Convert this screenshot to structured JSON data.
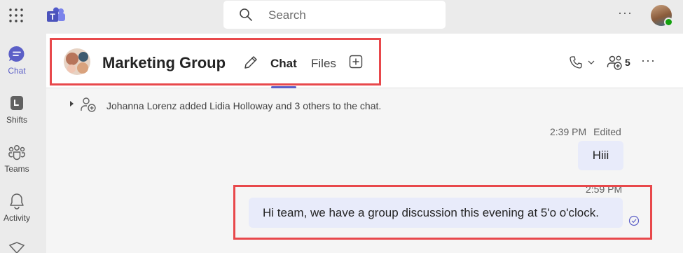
{
  "topbar": {
    "search_placeholder": "Search",
    "more": "···",
    "icons": [
      "apps-waffle-icon",
      "teams-logo-icon",
      "search-icon",
      "more-icon",
      "user-avatar"
    ]
  },
  "rail": {
    "items": [
      {
        "label": "Chat",
        "icon": "chat-icon",
        "active": true
      },
      {
        "label": "Shifts",
        "icon": "shifts-icon",
        "active": false
      },
      {
        "label": "Teams",
        "icon": "teams-icon",
        "active": false
      },
      {
        "label": "Activity",
        "icon": "bell-icon",
        "active": false
      }
    ]
  },
  "header": {
    "group_name": "Marketing Group",
    "tabs": [
      {
        "label": "Chat",
        "selected": true
      },
      {
        "label": "Files",
        "selected": false
      }
    ],
    "participants_count": "5",
    "more": "···"
  },
  "conversation": {
    "system_message": "Johanna Lorenz added Lidia Holloway and 3 others to the chat.",
    "messages": [
      {
        "time": "2:39 PM",
        "status": "Edited",
        "text": "Hiii"
      },
      {
        "time": "2:59 PM",
        "status": "",
        "text": "Hi team, we have a group discussion this evening at 5'o o'clock."
      }
    ]
  },
  "colors": {
    "accent": "#5b5fc7",
    "bubble": "#e8ebfa",
    "annotation": "#e8484b",
    "presence": "#13a10e"
  }
}
